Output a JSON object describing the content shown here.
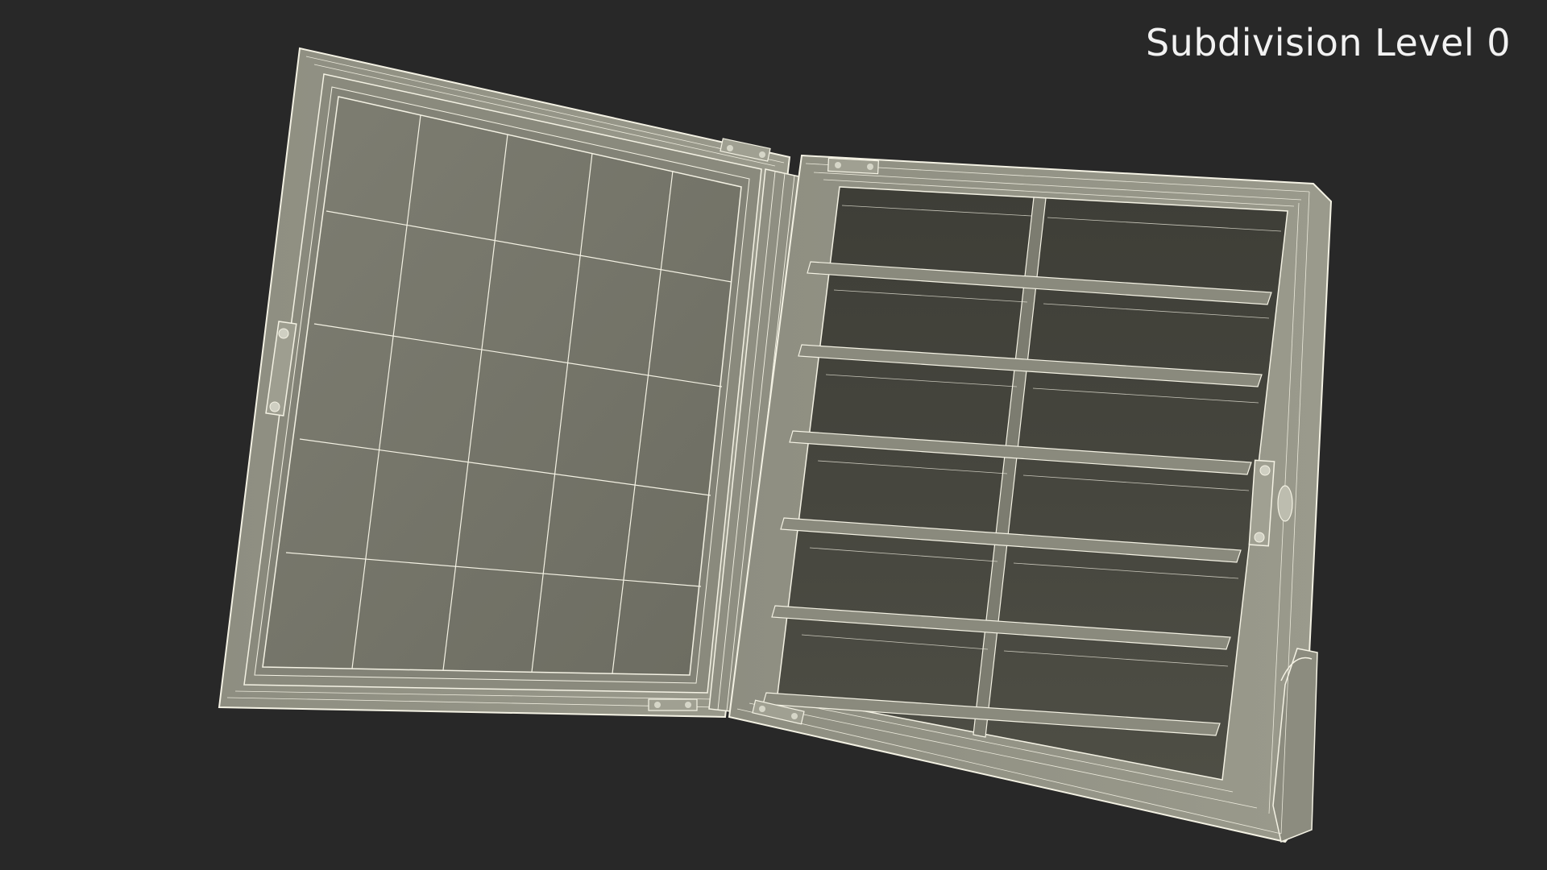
{
  "scene": {
    "subdivision_label": "Subdivision Level 0",
    "background_color": "#282828",
    "wire_color": "#f4f2e4",
    "frame_color": "#8d8d80",
    "lid_panel_color": "#78786c",
    "cavity_color": "#45453d"
  }
}
